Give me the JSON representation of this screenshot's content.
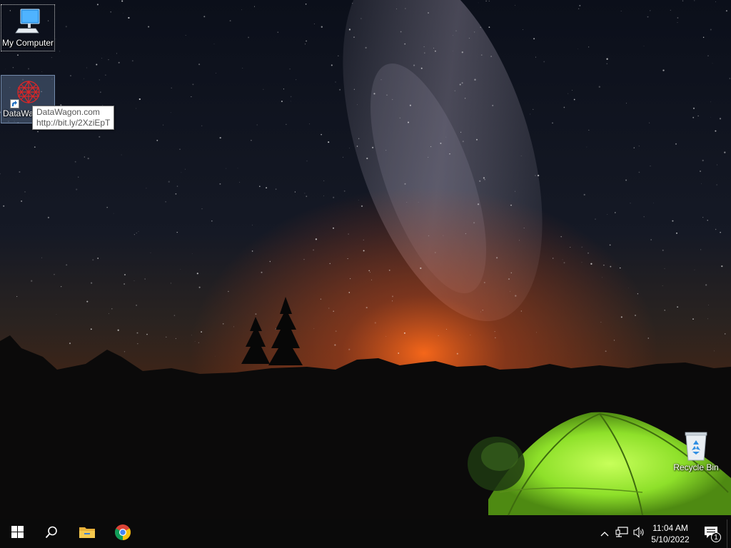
{
  "desktop": {
    "icons": [
      {
        "label": "My Computer",
        "icon": "monitor-icon"
      },
      {
        "label": "DataWagon",
        "icon": "datawagon-logo-icon"
      },
      {
        "label": "Recycle Bin",
        "icon": "recycle-bin-icon"
      }
    ],
    "tooltip": {
      "line1": "DataWagon.com",
      "line2": "http://bit.ly/2XziEpT"
    }
  },
  "taskbar": {
    "start_icon": "windows-logo-icon",
    "search_icon": "search-icon",
    "pinned": [
      {
        "name": "File Explorer",
        "icon": "folder-icon"
      },
      {
        "name": "Google Chrome",
        "icon": "chrome-icon"
      }
    ],
    "tray": {
      "icons": [
        "chevron-up-icon",
        "network-icon",
        "volume-icon"
      ],
      "time": "11:04 AM",
      "date": "5/10/2022",
      "notification_count": "1"
    }
  },
  "colors": {
    "taskbar_bg": "#0a0a0a",
    "tent_green": "#8ee02a",
    "horizon_glow": "#ff6a1a",
    "sky": "#0d1220"
  }
}
